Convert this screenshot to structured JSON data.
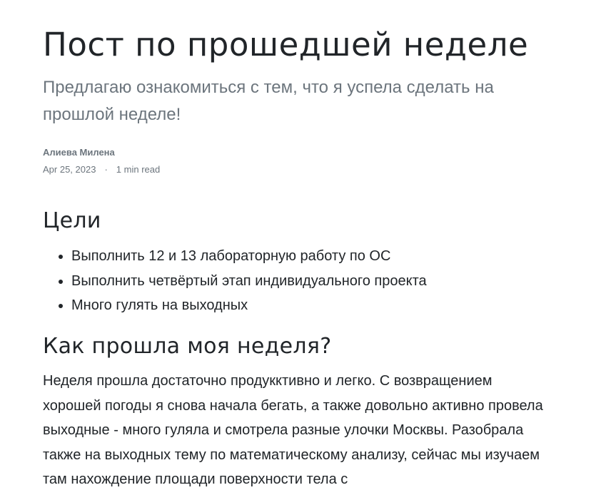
{
  "post": {
    "title": "Пост по прошедшей неделе",
    "subtitle": "Предлагаю ознакомиться с тем, что я успела сделать на прошлой неделе!",
    "author": "Алиева Милена",
    "date": "Apr 25, 2023",
    "separator": "·",
    "read_time": "1 min read"
  },
  "sections": {
    "goals": {
      "heading": "Цели",
      "items": [
        "Выполнить 12 и 13 лабораторную работу по ОС",
        "Выполнить четвёртый этап индивидуального проекта",
        "Много гулять на выходных"
      ]
    },
    "week": {
      "heading": "Как прошла моя неделя?",
      "paragraph": "Неделя прошла достаточно продукктивно и легко. С возвращением хорошей погоды я снова начала бегать, а также довольно активно провела выходные - много гуляла и смотрела разные улочки Москвы. Разобрала также на выходных тему по математическому анализу, сейчас мы изучаем там нахождение площади поверхности тела с"
    }
  }
}
